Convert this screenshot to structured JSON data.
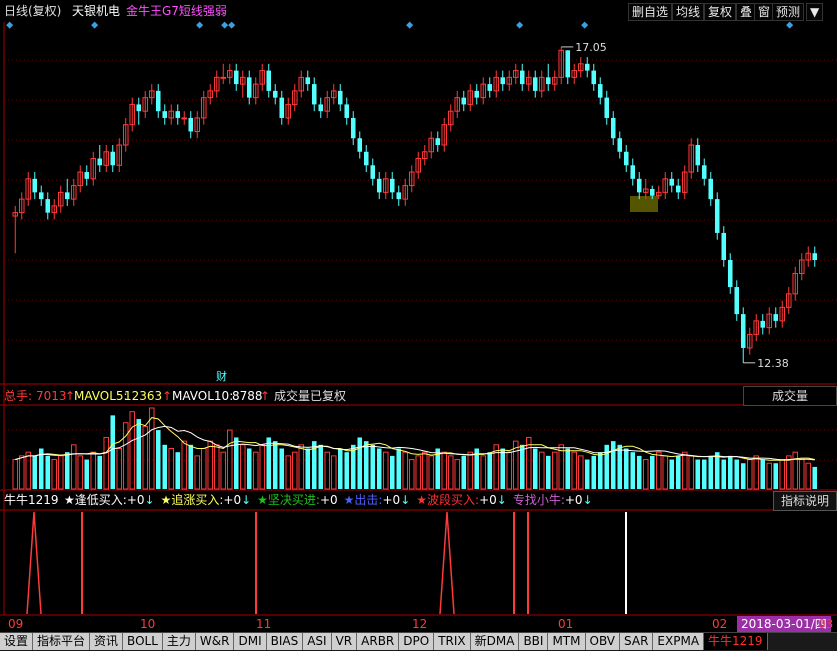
{
  "header": {
    "period": "日线(复权)",
    "stock_name": "天银机电",
    "indicator_name": "金牛王G7短线强弱",
    "buttons": [
      "删自选",
      "均线",
      "复权",
      "叠",
      "窗",
      "预测",
      "▼"
    ]
  },
  "main_chart": {
    "high_label": "17.05",
    "low_label": "12.38",
    "finance_marker": "财",
    "candles": [
      [
        14.55,
        14.6,
        14.7,
        14.0
      ],
      [
        14.6,
        14.8,
        14.9,
        14.5
      ],
      [
        14.8,
        15.1,
        15.2,
        14.7
      ],
      [
        15.1,
        14.9,
        15.2,
        14.8
      ],
      [
        14.9,
        14.8,
        15.0,
        14.7
      ],
      [
        14.8,
        14.6,
        14.9,
        14.5
      ],
      [
        14.6,
        14.7,
        14.8,
        14.5
      ],
      [
        14.7,
        14.9,
        15.0,
        14.6
      ],
      [
        14.9,
        14.8,
        15.1,
        14.7
      ],
      [
        14.8,
        15.0,
        15.1,
        14.7
      ],
      [
        15.0,
        15.2,
        15.3,
        14.9
      ],
      [
        15.2,
        15.1,
        15.3,
        15.0
      ],
      [
        15.1,
        15.4,
        15.5,
        15.0
      ],
      [
        15.4,
        15.3,
        15.6,
        15.2
      ],
      [
        15.3,
        15.5,
        15.6,
        15.2
      ],
      [
        15.5,
        15.3,
        15.6,
        15.2
      ],
      [
        15.3,
        15.6,
        15.7,
        15.2
      ],
      [
        15.6,
        15.9,
        16.0,
        15.5
      ],
      [
        15.9,
        16.2,
        16.3,
        15.8
      ],
      [
        16.2,
        16.1,
        16.3,
        15.9
      ],
      [
        16.1,
        16.3,
        16.4,
        16.0
      ],
      [
        16.3,
        16.4,
        16.5,
        16.2
      ],
      [
        16.4,
        16.1,
        16.5,
        16.0
      ],
      [
        16.1,
        16.0,
        16.2,
        15.9
      ],
      [
        16.0,
        16.1,
        16.2,
        15.9
      ],
      [
        16.1,
        16.0,
        16.2,
        15.9
      ],
      [
        16.0,
        16.0,
        16.1,
        15.9
      ],
      [
        16.0,
        15.8,
        16.1,
        15.7
      ],
      [
        15.8,
        16.0,
        16.1,
        15.7
      ],
      [
        16.0,
        16.3,
        16.4,
        15.9
      ],
      [
        16.3,
        16.4,
        16.5,
        16.2
      ],
      [
        16.4,
        16.6,
        16.7,
        16.3
      ],
      [
        16.6,
        16.6,
        16.8,
        16.5
      ],
      [
        16.6,
        16.7,
        16.8,
        16.5
      ],
      [
        16.7,
        16.5,
        16.8,
        16.4
      ],
      [
        16.5,
        16.6,
        16.7,
        16.3
      ],
      [
        16.6,
        16.3,
        16.7,
        16.2
      ],
      [
        16.3,
        16.5,
        16.6,
        16.2
      ],
      [
        16.5,
        16.7,
        16.8,
        16.4
      ],
      [
        16.7,
        16.4,
        16.8,
        16.3
      ],
      [
        16.4,
        16.3,
        16.5,
        16.2
      ],
      [
        16.3,
        16.0,
        16.4,
        15.9
      ],
      [
        16.0,
        16.2,
        16.3,
        15.9
      ],
      [
        16.2,
        16.4,
        16.5,
        16.1
      ],
      [
        16.4,
        16.6,
        16.7,
        16.3
      ],
      [
        16.6,
        16.5,
        16.7,
        16.4
      ],
      [
        16.5,
        16.2,
        16.6,
        16.1
      ],
      [
        16.2,
        16.1,
        16.3,
        16.0
      ],
      [
        16.1,
        16.3,
        16.4,
        16.0
      ],
      [
        16.3,
        16.4,
        16.5,
        16.2
      ],
      [
        16.4,
        16.2,
        16.5,
        16.1
      ],
      [
        16.2,
        16.0,
        16.3,
        15.9
      ],
      [
        16.0,
        15.7,
        16.1,
        15.6
      ],
      [
        15.7,
        15.5,
        15.8,
        15.4
      ],
      [
        15.5,
        15.3,
        15.6,
        15.2
      ],
      [
        15.3,
        15.1,
        15.4,
        15.0
      ],
      [
        15.1,
        14.9,
        15.2,
        14.8
      ],
      [
        14.9,
        15.1,
        15.2,
        14.8
      ],
      [
        15.1,
        14.9,
        15.2,
        14.8
      ],
      [
        14.9,
        14.8,
        15.0,
        14.7
      ],
      [
        14.8,
        15.0,
        15.1,
        14.7
      ],
      [
        15.0,
        15.2,
        15.3,
        14.9
      ],
      [
        15.2,
        15.4,
        15.5,
        15.1
      ],
      [
        15.4,
        15.5,
        15.6,
        15.3
      ],
      [
        15.5,
        15.7,
        15.8,
        15.4
      ],
      [
        15.7,
        15.6,
        15.8,
        15.5
      ],
      [
        15.6,
        15.9,
        16.0,
        15.5
      ],
      [
        15.9,
        16.1,
        16.2,
        15.8
      ],
      [
        16.1,
        16.3,
        16.4,
        16.0
      ],
      [
        16.3,
        16.2,
        16.4,
        16.1
      ],
      [
        16.2,
        16.4,
        16.5,
        16.1
      ],
      [
        16.4,
        16.3,
        16.5,
        16.2
      ],
      [
        16.3,
        16.5,
        16.6,
        16.2
      ],
      [
        16.5,
        16.4,
        16.6,
        16.3
      ],
      [
        16.4,
        16.6,
        16.7,
        16.3
      ],
      [
        16.6,
        16.5,
        16.7,
        16.4
      ],
      [
        16.5,
        16.6,
        16.7,
        16.4
      ],
      [
        16.6,
        16.7,
        16.8,
        16.5
      ],
      [
        16.7,
        16.5,
        16.8,
        16.4
      ],
      [
        16.5,
        16.6,
        16.7,
        16.4
      ],
      [
        16.6,
        16.4,
        16.7,
        16.3
      ],
      [
        16.4,
        16.6,
        16.7,
        16.3
      ],
      [
        16.6,
        16.5,
        16.8,
        16.4
      ],
      [
        16.5,
        16.6,
        16.7,
        16.4
      ],
      [
        16.6,
        17.0,
        17.05,
        16.5
      ],
      [
        17.0,
        16.6,
        17.0,
        16.5
      ],
      [
        16.6,
        16.7,
        16.8,
        16.5
      ],
      [
        16.7,
        16.8,
        16.9,
        16.6
      ],
      [
        16.8,
        16.7,
        16.9,
        16.6
      ],
      [
        16.7,
        16.5,
        16.8,
        16.4
      ],
      [
        16.5,
        16.3,
        16.6,
        16.2
      ],
      [
        16.3,
        16.0,
        16.4,
        15.9
      ],
      [
        16.0,
        15.7,
        16.1,
        15.6
      ],
      [
        15.7,
        15.5,
        15.8,
        15.4
      ],
      [
        15.5,
        15.3,
        15.6,
        15.2
      ],
      [
        15.3,
        15.1,
        15.4,
        15.0
      ],
      [
        15.1,
        14.9,
        15.2,
        14.8
      ],
      [
        14.9,
        14.95,
        15.1,
        14.8
      ],
      [
        14.95,
        14.85,
        15.0,
        14.8
      ],
      [
        14.85,
        14.9,
        15.0,
        14.8
      ],
      [
        14.9,
        15.1,
        15.2,
        14.8
      ],
      [
        15.1,
        15.0,
        15.2,
        14.9
      ],
      [
        15.0,
        14.9,
        15.1,
        14.8
      ],
      [
        14.9,
        15.2,
        15.3,
        14.8
      ],
      [
        15.2,
        15.6,
        15.7,
        15.1
      ],
      [
        15.6,
        15.3,
        15.7,
        15.2
      ],
      [
        15.3,
        15.1,
        15.4,
        15.0
      ],
      [
        15.1,
        14.8,
        15.2,
        14.7
      ],
      [
        14.8,
        14.3,
        14.9,
        14.2
      ],
      [
        14.3,
        13.9,
        14.4,
        13.8
      ],
      [
        13.9,
        13.5,
        14.0,
        13.4
      ],
      [
        13.5,
        13.1,
        13.6,
        13.0
      ],
      [
        13.1,
        12.6,
        13.2,
        12.38
      ],
      [
        12.6,
        12.8,
        12.9,
        12.5
      ],
      [
        12.8,
        13.0,
        13.1,
        12.7
      ],
      [
        13.0,
        12.9,
        13.1,
        12.8
      ],
      [
        12.9,
        13.1,
        13.2,
        12.8
      ],
      [
        13.1,
        13.0,
        13.2,
        12.9
      ],
      [
        13.0,
        13.2,
        13.3,
        12.9
      ],
      [
        13.2,
        13.4,
        13.5,
        13.1
      ],
      [
        13.4,
        13.7,
        13.8,
        13.3
      ],
      [
        13.7,
        13.9,
        14.0,
        13.6
      ],
      [
        13.9,
        14.0,
        14.1,
        13.8
      ],
      [
        14.0,
        13.9,
        14.1,
        13.8
      ]
    ]
  },
  "volume": {
    "label_total": "总手:",
    "total_value": "7013",
    "total_arrow": "↑",
    "mavol5_label": "MAVOL5:",
    "mavol5_value": "12363",
    "mavol5_arrow": "↑",
    "mavol10_label": "MAVOL10:",
    "mavol10_value": "8788",
    "mavol10_arrow": "↑",
    "note": "成交量已复权",
    "dropdown": "成交量",
    "bars": [
      8,
      9,
      10,
      9,
      11,
      9,
      8,
      9,
      10,
      12,
      9,
      8,
      10,
      9,
      14,
      20,
      11,
      18,
      21,
      19,
      17,
      22,
      16,
      12,
      11,
      10,
      13,
      12,
      9,
      11,
      13,
      12,
      10,
      16,
      14,
      12,
      11,
      10,
      12,
      14,
      13,
      11,
      9,
      10,
      12,
      11,
      13,
      12,
      10,
      9,
      11,
      10,
      12,
      14,
      13,
      12,
      11,
      10,
      9,
      11,
      10,
      8,
      9,
      10,
      9,
      11,
      10,
      9,
      8,
      9,
      10,
      11,
      9,
      10,
      12,
      11,
      10,
      13,
      12,
      14,
      11,
      10,
      9,
      10,
      12,
      11,
      10,
      9,
      8,
      9,
      10,
      12,
      13,
      12,
      11,
      10,
      9,
      8,
      9,
      10,
      9,
      8,
      9,
      10,
      9,
      8,
      8,
      9,
      10,
      8,
      9,
      8,
      7,
      8,
      9,
      8,
      7,
      7,
      8,
      9,
      10,
      8,
      7,
      6
    ]
  },
  "indicator": {
    "name": "牛牛1219",
    "items": [
      {
        "label": "★逢低买入:",
        "value": "+0",
        "arrow": "↓",
        "color": "#ffffff"
      },
      {
        "label": "★追涨买入:",
        "value": "+0",
        "arrow": "↓",
        "color": "#ffff60"
      },
      {
        "label": "★坚决买进:",
        "value": "+0",
        "arrow": "",
        "color": "#20c020"
      },
      {
        "label": "★出击:",
        "value": "+0",
        "arrow": "↓",
        "color": "#5060ff"
      },
      {
        "label": "★波段买入:",
        "value": "+0",
        "arrow": "↓",
        "color": "#ff3030"
      },
      {
        "label": "专找小牛:",
        "value": "+0",
        "arrow": "↓",
        "color": "#d060d0"
      }
    ],
    "button": "指标说明"
  },
  "xaxis": {
    "labels": [
      "09",
      "10",
      "11",
      "12",
      "01",
      "02",
      "03"
    ],
    "current_date": "2018-03-01/四"
  },
  "tabs": [
    "设置",
    "指标平台",
    "资讯",
    "BOLL",
    "主力",
    "W&R",
    "DMI",
    "BIAS",
    "ASI",
    "VR",
    "ARBR",
    "DPO",
    "TRIX",
    "新DMA",
    "BBI",
    "MTM",
    "OBV",
    "SAR",
    "EXPMA",
    "牛牛1219"
  ],
  "colors": {
    "up": "#ff3a3a",
    "down": "#54ffff",
    "ma": "#ffffff",
    "grid": "#7a0000",
    "diamond": "#3aa0e0"
  }
}
